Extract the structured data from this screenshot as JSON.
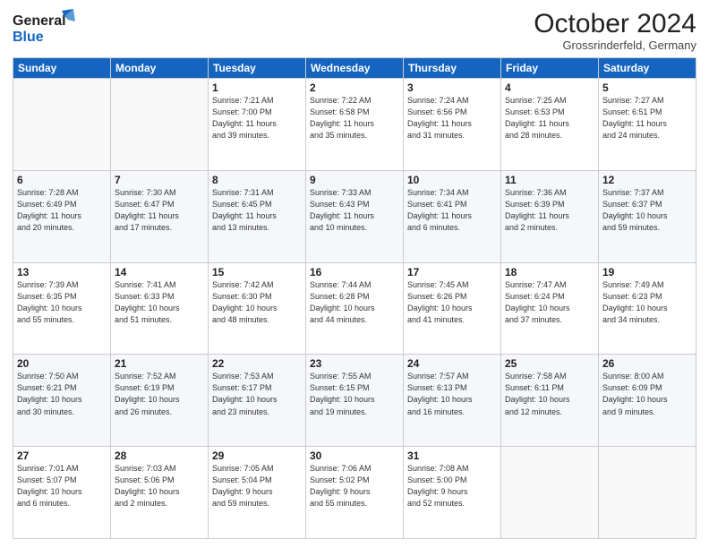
{
  "header": {
    "logo_general": "General",
    "logo_blue": "Blue",
    "month": "October 2024",
    "location": "Grossrinderfeld, Germany"
  },
  "days_of_week": [
    "Sunday",
    "Monday",
    "Tuesday",
    "Wednesday",
    "Thursday",
    "Friday",
    "Saturday"
  ],
  "weeks": [
    [
      {
        "day": "",
        "info": ""
      },
      {
        "day": "",
        "info": ""
      },
      {
        "day": "1",
        "info": "Sunrise: 7:21 AM\nSunset: 7:00 PM\nDaylight: 11 hours\nand 39 minutes."
      },
      {
        "day": "2",
        "info": "Sunrise: 7:22 AM\nSunset: 6:58 PM\nDaylight: 11 hours\nand 35 minutes."
      },
      {
        "day": "3",
        "info": "Sunrise: 7:24 AM\nSunset: 6:56 PM\nDaylight: 11 hours\nand 31 minutes."
      },
      {
        "day": "4",
        "info": "Sunrise: 7:25 AM\nSunset: 6:53 PM\nDaylight: 11 hours\nand 28 minutes."
      },
      {
        "day": "5",
        "info": "Sunrise: 7:27 AM\nSunset: 6:51 PM\nDaylight: 11 hours\nand 24 minutes."
      }
    ],
    [
      {
        "day": "6",
        "info": "Sunrise: 7:28 AM\nSunset: 6:49 PM\nDaylight: 11 hours\nand 20 minutes."
      },
      {
        "day": "7",
        "info": "Sunrise: 7:30 AM\nSunset: 6:47 PM\nDaylight: 11 hours\nand 17 minutes."
      },
      {
        "day": "8",
        "info": "Sunrise: 7:31 AM\nSunset: 6:45 PM\nDaylight: 11 hours\nand 13 minutes."
      },
      {
        "day": "9",
        "info": "Sunrise: 7:33 AM\nSunset: 6:43 PM\nDaylight: 11 hours\nand 10 minutes."
      },
      {
        "day": "10",
        "info": "Sunrise: 7:34 AM\nSunset: 6:41 PM\nDaylight: 11 hours\nand 6 minutes."
      },
      {
        "day": "11",
        "info": "Sunrise: 7:36 AM\nSunset: 6:39 PM\nDaylight: 11 hours\nand 2 minutes."
      },
      {
        "day": "12",
        "info": "Sunrise: 7:37 AM\nSunset: 6:37 PM\nDaylight: 10 hours\nand 59 minutes."
      }
    ],
    [
      {
        "day": "13",
        "info": "Sunrise: 7:39 AM\nSunset: 6:35 PM\nDaylight: 10 hours\nand 55 minutes."
      },
      {
        "day": "14",
        "info": "Sunrise: 7:41 AM\nSunset: 6:33 PM\nDaylight: 10 hours\nand 51 minutes."
      },
      {
        "day": "15",
        "info": "Sunrise: 7:42 AM\nSunset: 6:30 PM\nDaylight: 10 hours\nand 48 minutes."
      },
      {
        "day": "16",
        "info": "Sunrise: 7:44 AM\nSunset: 6:28 PM\nDaylight: 10 hours\nand 44 minutes."
      },
      {
        "day": "17",
        "info": "Sunrise: 7:45 AM\nSunset: 6:26 PM\nDaylight: 10 hours\nand 41 minutes."
      },
      {
        "day": "18",
        "info": "Sunrise: 7:47 AM\nSunset: 6:24 PM\nDaylight: 10 hours\nand 37 minutes."
      },
      {
        "day": "19",
        "info": "Sunrise: 7:49 AM\nSunset: 6:23 PM\nDaylight: 10 hours\nand 34 minutes."
      }
    ],
    [
      {
        "day": "20",
        "info": "Sunrise: 7:50 AM\nSunset: 6:21 PM\nDaylight: 10 hours\nand 30 minutes."
      },
      {
        "day": "21",
        "info": "Sunrise: 7:52 AM\nSunset: 6:19 PM\nDaylight: 10 hours\nand 26 minutes."
      },
      {
        "day": "22",
        "info": "Sunrise: 7:53 AM\nSunset: 6:17 PM\nDaylight: 10 hours\nand 23 minutes."
      },
      {
        "day": "23",
        "info": "Sunrise: 7:55 AM\nSunset: 6:15 PM\nDaylight: 10 hours\nand 19 minutes."
      },
      {
        "day": "24",
        "info": "Sunrise: 7:57 AM\nSunset: 6:13 PM\nDaylight: 10 hours\nand 16 minutes."
      },
      {
        "day": "25",
        "info": "Sunrise: 7:58 AM\nSunset: 6:11 PM\nDaylight: 10 hours\nand 12 minutes."
      },
      {
        "day": "26",
        "info": "Sunrise: 8:00 AM\nSunset: 6:09 PM\nDaylight: 10 hours\nand 9 minutes."
      }
    ],
    [
      {
        "day": "27",
        "info": "Sunrise: 7:01 AM\nSunset: 5:07 PM\nDaylight: 10 hours\nand 6 minutes."
      },
      {
        "day": "28",
        "info": "Sunrise: 7:03 AM\nSunset: 5:06 PM\nDaylight: 10 hours\nand 2 minutes."
      },
      {
        "day": "29",
        "info": "Sunrise: 7:05 AM\nSunset: 5:04 PM\nDaylight: 9 hours\nand 59 minutes."
      },
      {
        "day": "30",
        "info": "Sunrise: 7:06 AM\nSunset: 5:02 PM\nDaylight: 9 hours\nand 55 minutes."
      },
      {
        "day": "31",
        "info": "Sunrise: 7:08 AM\nSunset: 5:00 PM\nDaylight: 9 hours\nand 52 minutes."
      },
      {
        "day": "",
        "info": ""
      },
      {
        "day": "",
        "info": ""
      }
    ]
  ]
}
